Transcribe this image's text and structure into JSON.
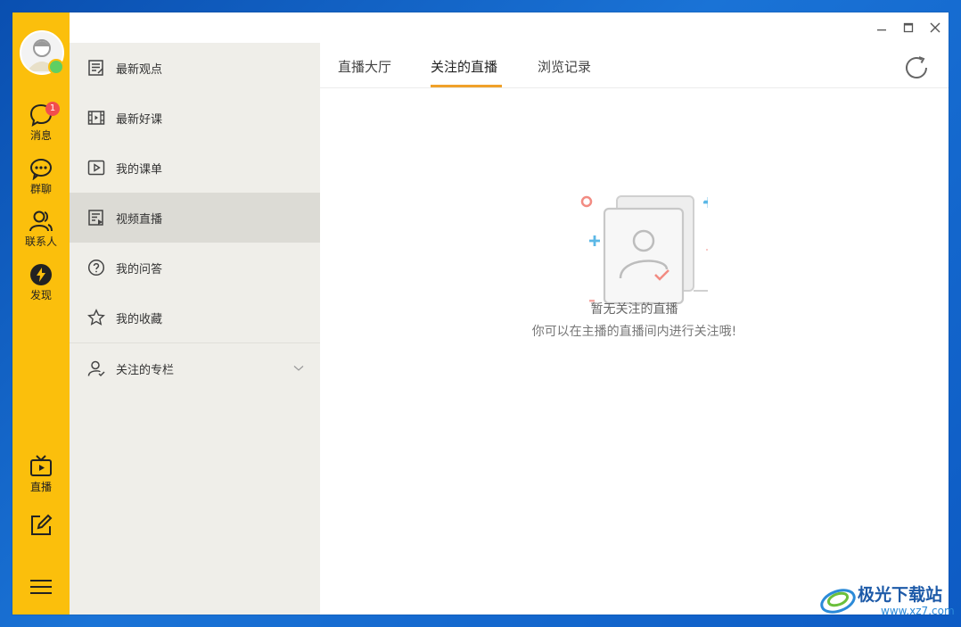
{
  "rail": {
    "items": [
      {
        "label": "消息",
        "icon": "chat-bubble-icon",
        "badge": "1"
      },
      {
        "label": "群聊",
        "icon": "group-chat-icon"
      },
      {
        "label": "联系人",
        "icon": "contacts-icon"
      },
      {
        "label": "发现",
        "icon": "discover-icon"
      }
    ],
    "bottom": [
      {
        "label": "直播",
        "icon": "tv-icon"
      },
      {
        "label": "",
        "icon": "edit-icon"
      }
    ],
    "menu_icon": "hamburger-icon",
    "accent": "#fbbf0c",
    "online_status_color": "#5fcf63"
  },
  "sidebar": {
    "items": [
      {
        "label": "最新观点",
        "icon": "article-icon"
      },
      {
        "label": "最新好课",
        "icon": "film-icon"
      },
      {
        "label": "我的课单",
        "icon": "play-list-icon"
      },
      {
        "label": "视频直播",
        "icon": "live-doc-icon",
        "active": true
      },
      {
        "label": "我的问答",
        "icon": "question-icon"
      },
      {
        "label": "我的收藏",
        "icon": "star-icon"
      }
    ],
    "expandable": {
      "label": "关注的专栏",
      "icon": "user-follow-icon"
    }
  },
  "tabs": [
    {
      "label": "直播大厅"
    },
    {
      "label": "关注的直播",
      "active": true
    },
    {
      "label": "浏览记录"
    }
  ],
  "empty_state": {
    "title": "暂无关注的直播",
    "subtitle": "你可以在主播的直播间内进行关注哦!"
  },
  "watermark": {
    "name": "极光下载站",
    "url": "www.xz7.com"
  }
}
